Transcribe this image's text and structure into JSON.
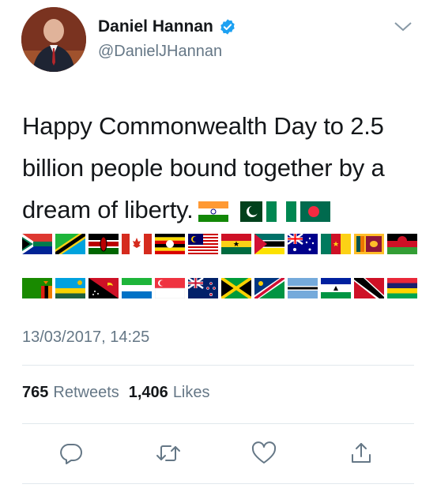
{
  "author": {
    "name": "Daniel Hannan",
    "handle": "@DanielJHannan",
    "verified": true
  },
  "tweet": {
    "text": "Happy Commonwealth Day to 2.5 billion people bound together by a dream of liberty.",
    "inline_flags": [
      "india-flag-icon",
      "pakistan-flag-icon",
      "nigeria-flag-icon",
      "bangladesh-flag-icon"
    ],
    "flags_row1": [
      "south-africa-flag-icon",
      "tanzania-flag-icon",
      "kenya-flag-icon",
      "canada-flag-icon",
      "uganda-flag-icon",
      "malaysia-flag-icon",
      "ghana-flag-icon",
      "mozambique-flag-icon",
      "australia-flag-icon",
      "cameroon-flag-icon",
      "sri-lanka-flag-icon",
      "malawi-flag-icon"
    ],
    "flags_row2": [
      "zambia-flag-icon",
      "rwanda-flag-icon",
      "papua-new-guinea-flag-icon",
      "sierra-leone-flag-icon",
      "singapore-flag-icon",
      "new-zealand-flag-icon",
      "jamaica-flag-icon",
      "namibia-flag-icon",
      "botswana-flag-icon",
      "lesotho-flag-icon",
      "trinidad-and-tobago-flag-icon",
      "mauritius-flag-icon"
    ],
    "timestamp": "13/03/2017, 14:25"
  },
  "stats": {
    "retweets_count": "765",
    "retweets_label": "Retweets",
    "likes_count": "1,406",
    "likes_label": "Likes"
  },
  "colors": {
    "text": "#14171a",
    "secondary": "#657786",
    "verified_blue": "#1da1f2",
    "divider": "#e1e8ed"
  },
  "icons": {
    "menu": "chevron-down-icon",
    "reply": "reply-icon",
    "retweet": "retweet-icon",
    "like": "heart-icon",
    "share": "share-icon"
  }
}
